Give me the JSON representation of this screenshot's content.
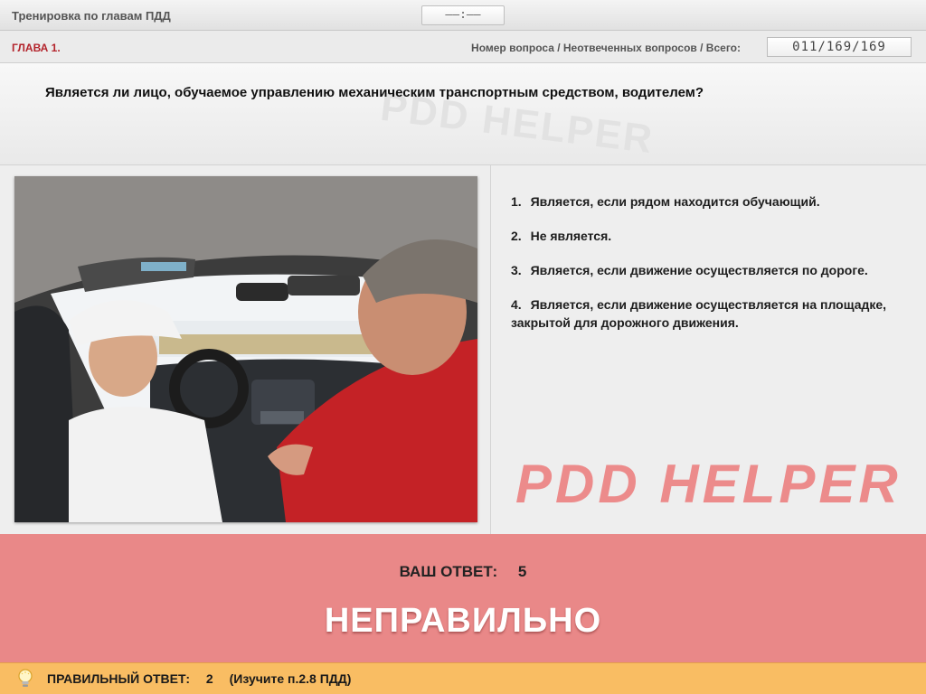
{
  "header": {
    "title": "Тренировка по главам ПДД",
    "timer": "––:––"
  },
  "chapter_bar": {
    "chapter": "ГЛАВА 1.",
    "counter_label": "Номер вопроса / Неотвеченных вопросов / Всего:",
    "counter_value": "011/169/169"
  },
  "question": {
    "text": "Является ли лицо, обучаемое управлению механическим транспортным средством, водителем?"
  },
  "answers": [
    {
      "num": "1.",
      "text": "Является, если рядом находится обучающий."
    },
    {
      "num": "2.",
      "text": "Не является."
    },
    {
      "num": "3.",
      "text": "Является, если движение осуществляется по дороге."
    },
    {
      "num": "4.",
      "text": "Является, если движение осуществляется на площадке, закрытой для дорожного движения."
    }
  ],
  "watermark": "PDD HELPER",
  "result": {
    "your_answer_label": "ВАШ ОТВЕТ:",
    "your_answer_value": "5",
    "verdict": "НЕПРАВИЛЬНО"
  },
  "correct": {
    "label": "ПРАВИЛЬНЫЙ ОТВЕТ:",
    "value": "2",
    "note": "(Изучите п.2.8 ПДД)",
    "icon": "lightbulb-icon"
  },
  "colors": {
    "chapter": "#b3232b",
    "result_bg": "#e98888",
    "correct_bg": "#f9bd63",
    "watermark": "#ec8b8b"
  }
}
